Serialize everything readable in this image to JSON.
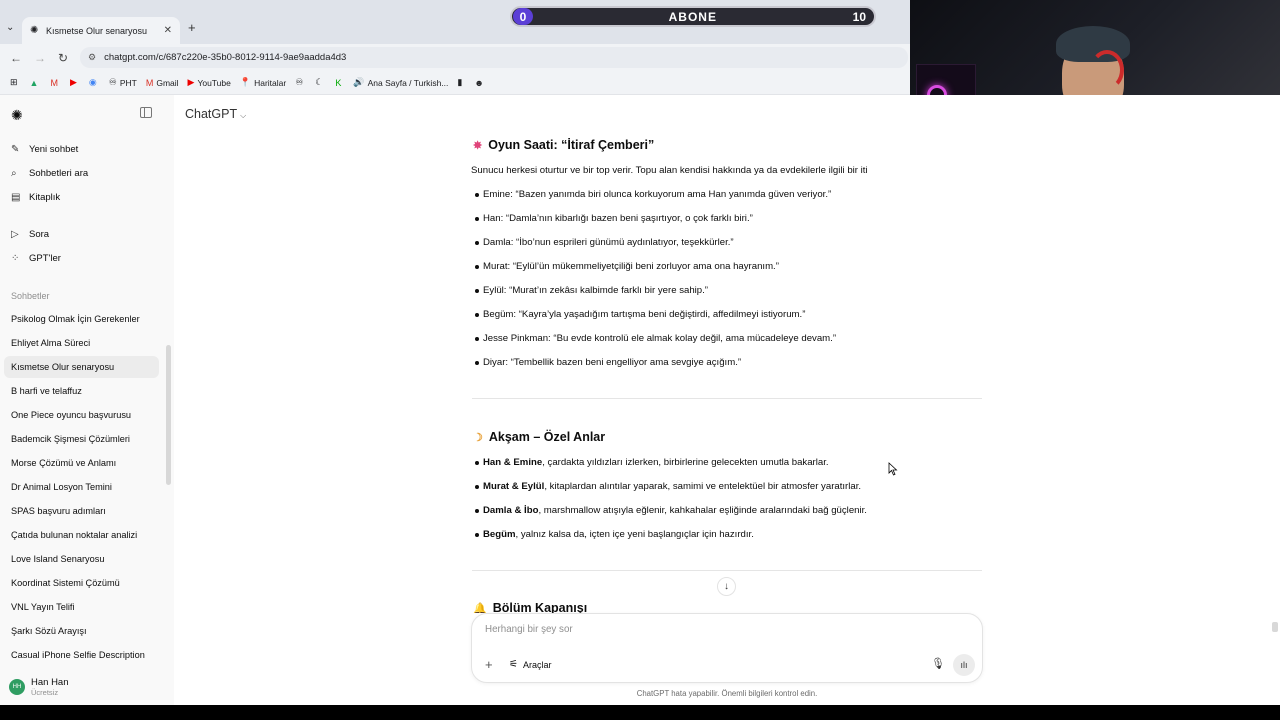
{
  "browser": {
    "tab_title": "Kısmetse Olur senaryosu",
    "url": "chatgpt.com/c/687c220e-35b0-8012-9114-9ae9aadda4d3",
    "bookmarks": [
      {
        "icon": "drive-icon",
        "label": ""
      },
      {
        "icon": "gmail-icon",
        "label": ""
      },
      {
        "icon": "youtube-icon",
        "label": ""
      },
      {
        "icon": "chrome-icon",
        "label": ""
      },
      {
        "icon": "pht-icon",
        "label": "PHT"
      },
      {
        "icon": "gmail-icon",
        "label": "Gmail"
      },
      {
        "icon": "youtube-icon",
        "label": "YouTube"
      },
      {
        "icon": "maps-icon",
        "label": "Haritalar"
      },
      {
        "icon": "bookmark-icon",
        "label": ""
      },
      {
        "icon": "moon-icon",
        "label": ""
      },
      {
        "icon": "k-icon",
        "label": ""
      },
      {
        "icon": "speaker-icon",
        "label": "Ana Sayfa / Turkish..."
      },
      {
        "icon": "book-icon",
        "label": ""
      },
      {
        "icon": "person-icon",
        "label": ""
      }
    ]
  },
  "overlay": {
    "current": "0",
    "label": "ABONE",
    "goal": "10",
    "progress": 0
  },
  "sidebar": {
    "nav": [
      {
        "icon": "edit-icon",
        "label": "Yeni sohbet"
      },
      {
        "icon": "search-icon",
        "label": "Sohbetleri ara"
      },
      {
        "icon": "library-icon",
        "label": "Kitaplık"
      },
      {
        "icon": "play-icon",
        "label": "Sora"
      },
      {
        "icon": "grid-icon",
        "label": "GPT'ler"
      }
    ],
    "section_label": "Sohbetler",
    "chats": [
      "Psikolog Olmak İçin Gerekenler",
      "Ehliyet Alma Süreci",
      "Kısmetse Olur senaryosu",
      "B harfi ve telaffuz",
      "One Piece oyuncu başvurusu",
      "Bademcik Şişmesi Çözümleri",
      "Morse Çözümü ve Anlamı",
      "Dr Animal Losyon Temini",
      "SPAS başvuru adımları",
      "Çatıda bulunan noktalar analizi",
      "Love Island Senaryosu",
      "Koordinat Sistemi Çözümü",
      "VNL Yayın Telifi",
      "Şarkı Sözü Arayışı",
      "Casual iPhone Selfie Description"
    ],
    "active_chat_index": 2,
    "user": {
      "initials": "HH",
      "name": "Han Han",
      "plan": "Ücretsiz"
    }
  },
  "header": {
    "model": "ChatGPT"
  },
  "message": {
    "section1": {
      "title": "Oyun Saati: “İtiraf Çemberi”",
      "intro": "Sunucu herkesi oturtur ve bir top verir. Topu alan kendisi hakkında ya da evdekilerle ilgili bir iti",
      "items": [
        "Emine: “Bazen yanımda biri olunca korkuyorum ama Han yanımda güven veriyor.”",
        "Han: “Damla’nın kibarlığı bazen beni şaşırtıyor, o çok farklı biri.”",
        "Damla: “İbo’nun esprileri günümü aydınlatıyor, teşekkürler.”",
        "Murat: “Eylül’ün mükemmeliyetçiliği beni zorluyor ama ona hayranım.”",
        "Eylül: “Murat’ın zekâsı kalbimde farklı bir yere sahip.”",
        "Begüm: “Kayra’yla yaşadığım tartışma beni değiştirdi, affedilmeyi istiyorum.”",
        "Jesse Pinkman: “Bu evde kontrolü ele almak kolay değil, ama mücadeleye devam.”",
        "Diyar: “Tembellik bazen beni engelliyor ama sevgiye açığım.”"
      ]
    },
    "section2": {
      "title": "Akşam – Özel Anlar",
      "items": [
        {
          "bold": "Han & Emine",
          "text": ", çardakta yıldızları izlerken, birbirlerine gelecekten umutla bakarlar."
        },
        {
          "bold": "Murat & Eylül",
          "text": ", kitaplardan alıntılar yaparak, samimi ve entelektüel bir atmosfer yaratırlar."
        },
        {
          "bold": "Damla & İbo",
          "text": ", marshmallow atışıyla eğlenir, kahkahalar eşliğinde aralarındaki bağ güçlenir."
        },
        {
          "bold": "Begüm",
          "text": ", yalnız kalsa da, içten içe yeni başlangıçlar için hazırdır."
        }
      ]
    },
    "section3": {
      "title": "Bölüm Kapanışı"
    }
  },
  "composer": {
    "placeholder": "Herhangi bir şey sor",
    "tools_label": "Araçlar"
  },
  "disclaimer": "ChatGPT hata yapabilir. Önemli bilgileri kontrol edin."
}
